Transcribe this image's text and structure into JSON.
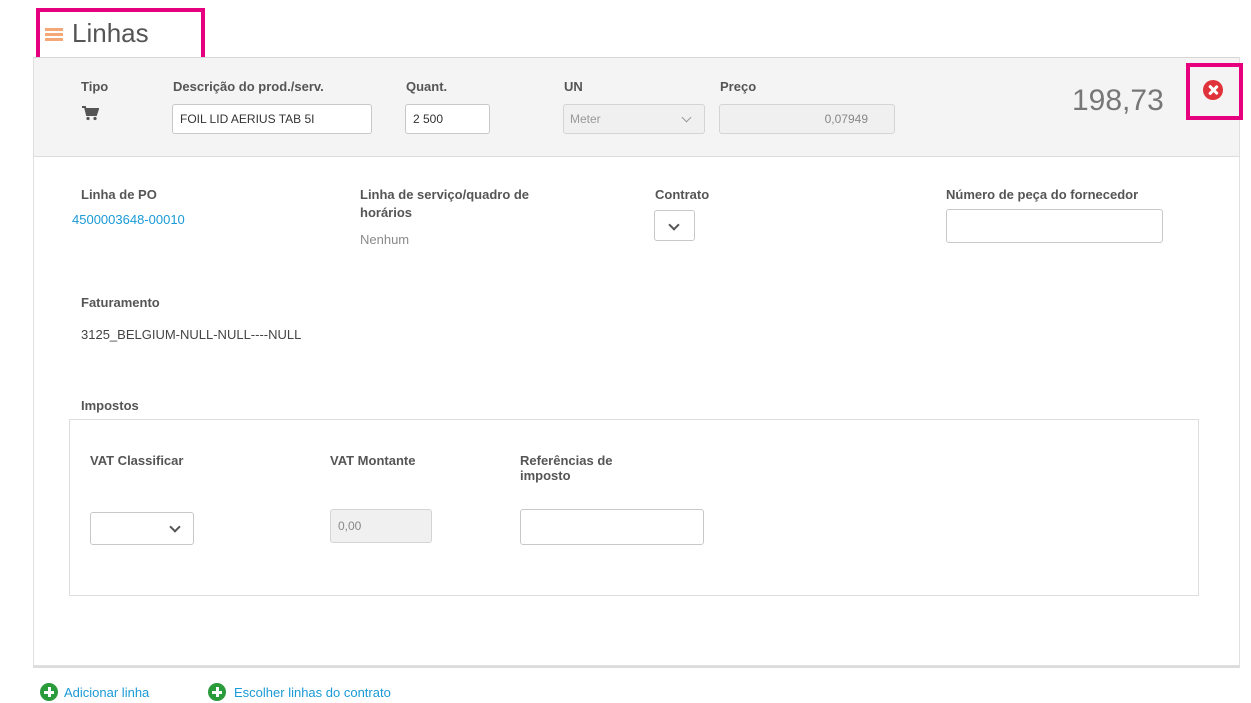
{
  "section": {
    "title": "Linhas",
    "icon": "lines-icon"
  },
  "line": {
    "header": {
      "tipo_label": "Tipo",
      "descricao_label": "Descrição do prod./serv.",
      "descricao_value": "FOIL LID AERIUS TAB 5I",
      "quant_label": "Quant.",
      "quant_value": "2 500",
      "un_label": "UN",
      "un_value": "Meter",
      "preco_label": "Preço",
      "preco_value": "0,07949",
      "total": "198,73"
    },
    "details": {
      "po_line_label": "Linha de PO",
      "po_line_value": "4500003648-00010",
      "service_line_label_1": "Linha de serviço/quadro de",
      "service_line_label_2": "horários",
      "service_line_value": "Nenhum",
      "contract_label": "Contrato",
      "supplier_part_label": "Número de peça do fornecedor",
      "supplier_part_value": "",
      "billing_label": "Faturamento",
      "billing_value": "3125_BELGIUM-NULL-NULL----NULL"
    },
    "taxes": {
      "section_label": "Impostos",
      "vat_class_label": "VAT Classificar",
      "vat_amount_label": "VAT Montante",
      "vat_amount_value": "0,00",
      "tax_refs_label_1": "Referências de",
      "tax_refs_label_2": "imposto",
      "tax_refs_value": ""
    }
  },
  "footer": {
    "add_line_label": "Adicionar linha",
    "choose_contract_lines_label": "Escolher linhas do contrato"
  },
  "colors": {
    "highlight": "#e6007e",
    "link": "#1a9ad6",
    "add": "#2a9b3b",
    "close": "#e0323a"
  }
}
